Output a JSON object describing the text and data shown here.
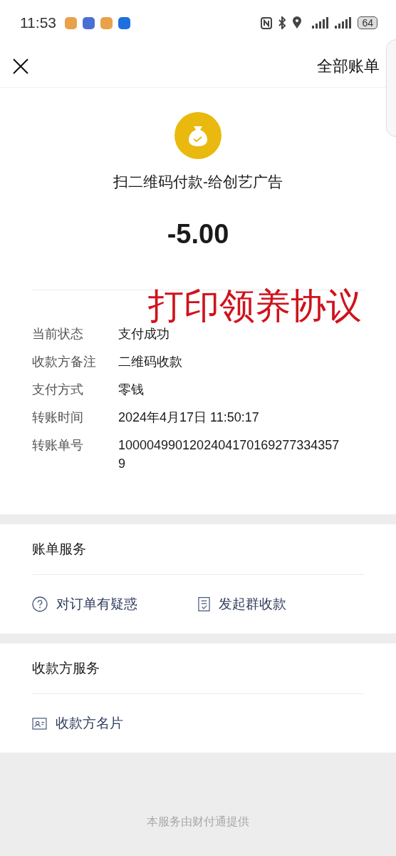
{
  "status_bar": {
    "time": "11:53",
    "battery": "64"
  },
  "header": {
    "action": "全部账单"
  },
  "payment": {
    "title": "扫二维码付款-给创艺广告",
    "amount": "-5.00"
  },
  "annotation": "打印领养协议",
  "details": [
    {
      "label": "当前状态",
      "value": "支付成功"
    },
    {
      "label": "收款方备注",
      "value": "二维码收款"
    },
    {
      "label": "支付方式",
      "value": "零钱"
    },
    {
      "label": "转账时间",
      "value": "2024年4月17日 11:50:17"
    },
    {
      "label": "转账单号",
      "value": "10000499012024041701692773343579"
    }
  ],
  "sections": [
    {
      "title": "账单服务",
      "items": [
        {
          "kind": "question",
          "label": "对订单有疑惑"
        },
        {
          "kind": "receipt",
          "label": "发起群收款"
        }
      ]
    },
    {
      "title": "收款方服务",
      "items": [
        {
          "kind": "card",
          "label": "收款方名片"
        }
      ]
    }
  ],
  "footer": "本服务由财付通提供"
}
